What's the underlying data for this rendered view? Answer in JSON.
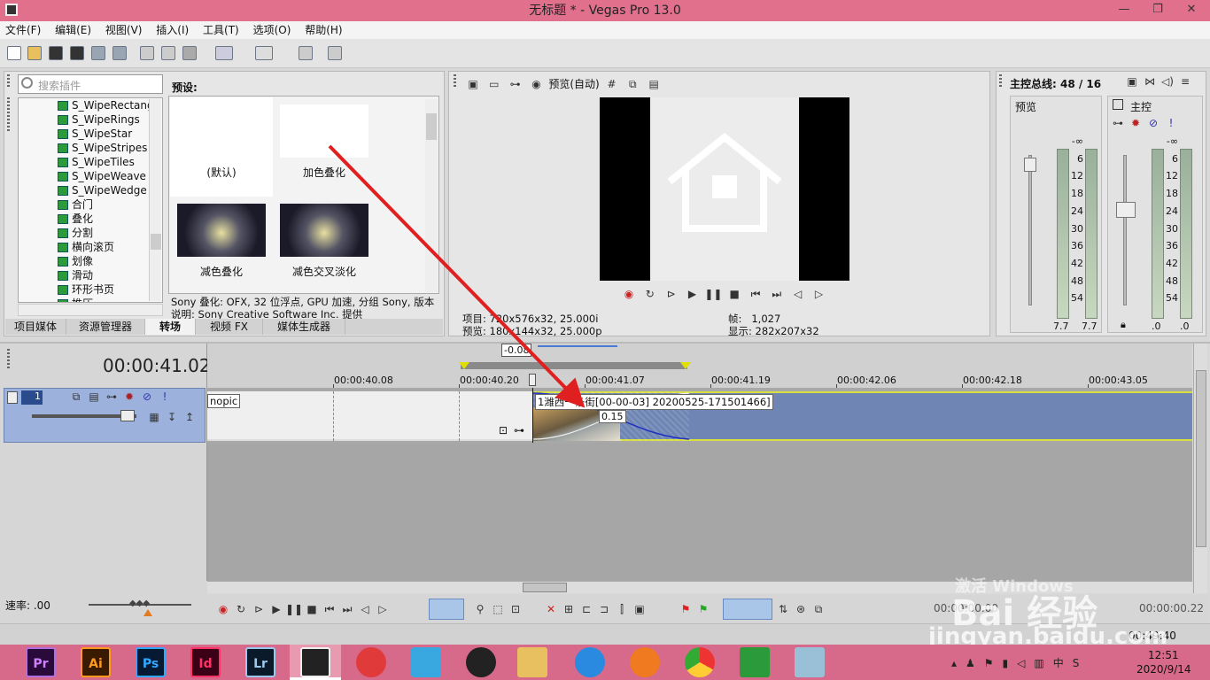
{
  "window": {
    "title": "无标题 * - Vegas Pro 13.0"
  },
  "menu": [
    "文件(F)",
    "编辑(E)",
    "视图(V)",
    "插入(I)",
    "工具(T)",
    "选项(O)",
    "帮助(H)"
  ],
  "plugins": {
    "search_placeholder": "搜索插件",
    "items": [
      "S_WipeRectang",
      "S_WipeRings",
      "S_WipeStar",
      "S_WipeStripes",
      "S_WipeTiles",
      "S_WipeWeave",
      "S_WipeWedge",
      "合门",
      "叠化",
      "分割",
      "横向滚页",
      "划像",
      "滑动",
      "环形书页",
      "推压"
    ],
    "presets_label": "预设:",
    "presets": [
      "(默认)",
      "加色叠化",
      "减色叠化",
      "减色交叉淡化"
    ],
    "info_line1": "Sony 叠化: OFX, 32 位浮点, GPU 加速, 分组 Sony, 版本",
    "info_line2": "说明: Sony Creative Software Inc. 提供"
  },
  "left_tabs": [
    "项目媒体",
    "资源管理器",
    "转场",
    "视频 FX",
    "媒体生成器"
  ],
  "preview": {
    "mode": "预览(自动)",
    "project_label": "项目:",
    "project_value": "720x576x32, 25.000i",
    "preview_label": "预览:",
    "preview_value": "180x144x32, 25.000p",
    "frame_label": "帧:",
    "frame_value": "1,027",
    "display_label": "显示:",
    "display_value": "282x207x32"
  },
  "mixer": {
    "title": "主控总线: 48 / 16",
    "preview_label": "预览",
    "master_label": "主控",
    "scale": [
      "-∞",
      "6",
      "12",
      "18",
      "24",
      "30",
      "36",
      "42",
      "48",
      "54"
    ],
    "left_values": [
      "7.7",
      "7.7"
    ],
    "right_values": [
      ".0",
      ".0"
    ]
  },
  "timeline": {
    "timecode": "00:00:41.02",
    "offset": "-0.08",
    "ruler": [
      "00:00:40.08",
      "00:00:40.20",
      "00:00:41.07",
      "00:00:41.19",
      "00:00:42.06",
      "00:00:42.18",
      "00:00:43.05"
    ],
    "track_number": "1",
    "clip_left": "nopic",
    "clip_right": "1潍西一条街[00-00-03] 20200525-171501466]",
    "transition_len": "0.15",
    "rate_label": "速率: .00",
    "end_time": "00:00:00.22",
    "status_time": "00:49:40",
    "start_time": "00:00:00.00"
  },
  "taskbar": {
    "apps": [
      "Pr",
      "Ai",
      "Ps",
      "Id",
      "Lr"
    ],
    "time": "12:51",
    "date": "2020/9/14"
  },
  "watermark": {
    "brand": "Bai 经验",
    "url": "jingyan.baidu.com",
    "activate": "激活 Windows"
  },
  "colors": {
    "title": "#e0708c",
    "taskbar": "#d76a8a",
    "track": "#6f86b4",
    "arrow": "#e02020"
  }
}
